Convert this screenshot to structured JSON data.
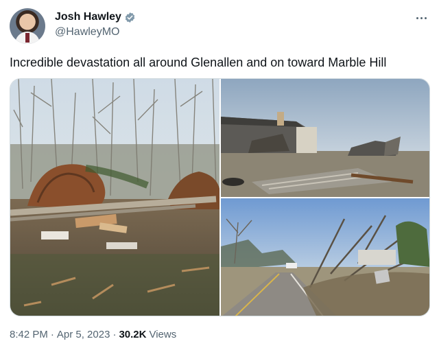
{
  "author": {
    "display_name": "Josh Hawley",
    "handle": "@HawleyMO",
    "verified": true,
    "avatar_icon": "profile-photo"
  },
  "tweet": {
    "text": "Incredible devastation all around Glenallen and on toward Marble Hill"
  },
  "media": {
    "photo_count": 3
  },
  "meta": {
    "time": "8:42 PM",
    "separator_1": "·",
    "date": "Apr 5, 2023",
    "separator_2": "·",
    "views_count": "30.2K",
    "views_label": "Views"
  },
  "colors": {
    "text_primary": "#0f1419",
    "text_secondary": "#536471",
    "verified_badge": "#829aab",
    "border": "#cfd9de"
  }
}
